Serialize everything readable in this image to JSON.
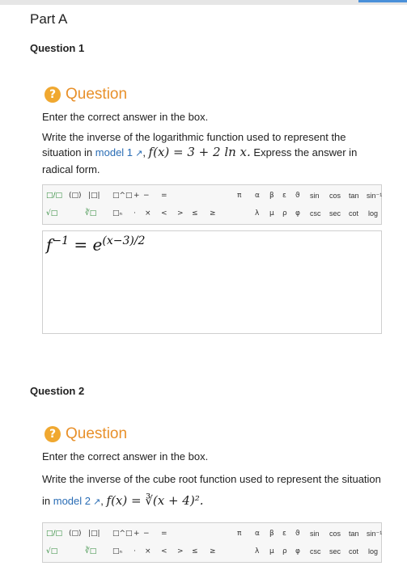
{
  "part": {
    "title": "Part A"
  },
  "questions": [
    {
      "number_label": "Question 1",
      "header": "Question",
      "instruction": "Enter the correct answer in the box.",
      "text_before": "Write the inverse of the logarithmic function used to represent the situation in",
      "link": "model 1",
      "function_tex": "f(x) = 3 + 2 ln x.",
      "text_after": "Express the answer in radical form.",
      "answer": {
        "base": "f",
        "exp1": "−1",
        "eq": " = e",
        "exp2": "(x−3)/2"
      }
    },
    {
      "number_label": "Question 2",
      "header": "Question",
      "instruction": "Enter the correct answer in the box.",
      "text_before": "Write the inverse of the cube root function used to represent the situation in",
      "link": "model 2",
      "function_tex": "f(x) = ∛(x + 4)².",
      "text_after": ""
    }
  ],
  "toolbar": {
    "row1": [
      "□/□",
      "(□)",
      "|□|",
      "□^□",
      "+",
      "−",
      "=",
      "π",
      "α",
      "β",
      "ε",
      "ϑ",
      "sin",
      "cos",
      "tan",
      "sin⁻¹"
    ],
    "row2": [
      "√□",
      "∛□",
      "□ₙ",
      "·",
      "×",
      "<",
      ">",
      "≤",
      "≥",
      "λ",
      "μ",
      "ρ",
      "φ",
      "csc",
      "sec",
      "cot",
      "log"
    ]
  },
  "colors": {
    "accent": "#e8902a",
    "link": "#2a6db5",
    "icon": "#f0a830"
  }
}
